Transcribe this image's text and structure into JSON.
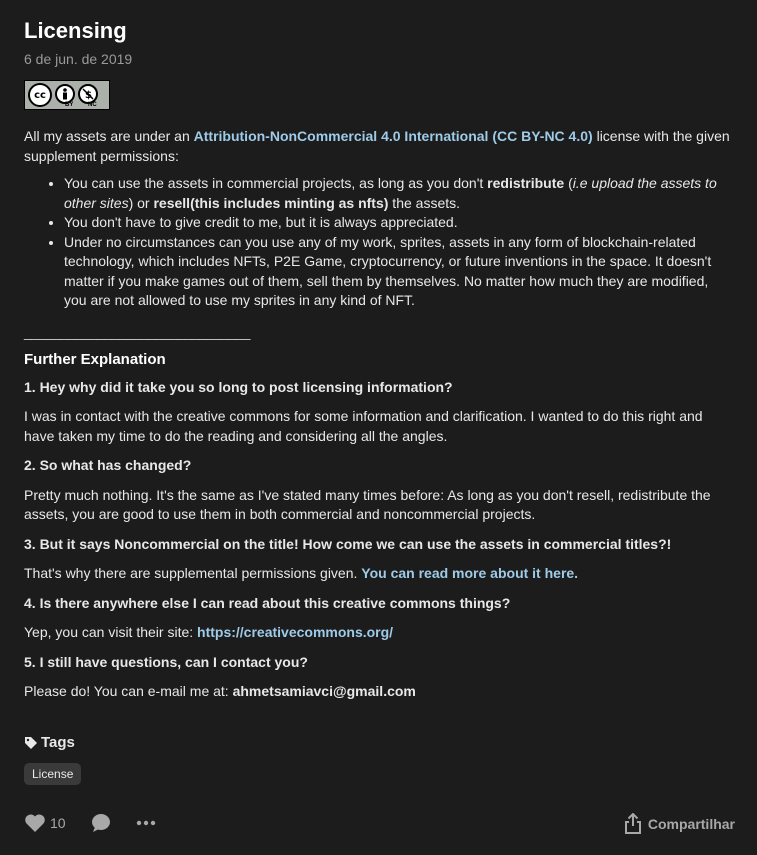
{
  "post": {
    "title": "Licensing",
    "date": "6 de jun. de 2019",
    "badge": {
      "cc": "cc",
      "by": "BY",
      "nc": "NC"
    }
  },
  "intro": {
    "before": "All my assets are under an  ",
    "license_link": "Attribution-NonCommercial 4.0 International (CC BY-NC 4.0)",
    "after": " license with the given supplement permissions:"
  },
  "bullets": {
    "b1": {
      "t1": "You can use the assets in commercial projects, as long as you don't ",
      "b_redistribute": "redistribute",
      "t2": " (",
      "i1": "i.e upload the assets to other sites",
      "t3": ") or ",
      "b_resell": "resell(this includes minting as nfts)",
      "t4": " the assets."
    },
    "b2": "You don't have to give credit to me, but it is always appreciated.",
    "b3": "Under no circumstances can you use any of my work, sprites, assets in any form of blockchain-related technology, which includes NFTs, P2E Game, cryptocurrency, or future inventions in the space. It doesn't matter if you make games out of them, sell them by themselves. No matter how much they are modified, you are not allowed to use my sprites in any kind of NFT."
  },
  "divider": "_______________________________",
  "further": {
    "heading": "Further Explanation",
    "q1": "1. Hey why did it take you so long to post licensing information?",
    "a1": "I was in contact with the creative commons for some information and clarification. I wanted to do this right and have taken my time to do the reading and considering all the angles.",
    "q2": "2. So what has changed?",
    "a2": "Pretty much nothing. It's the same as I've stated many times before: As long as you don't resell, redistribute the assets, you are good to use them in both commercial and noncommercial projects.",
    "q3": "3. But it says Noncommercial on the title! How come we can use the assets in commercial titles?!",
    "a3_text": "That's why there are supplemental permissions given. ",
    "a3_link": "You can read more about it here.",
    "q4": "4. Is there anywhere else I can read about this creative commons things?",
    "a4_text": "Yep, you can visit their site:  ",
    "a4_link": "https://creativecommons.org/",
    "q5": "5. I still have questions, can I contact you?",
    "a5_text": "Please do! You can e-mail me at: ",
    "a5_email": "ahmetsamiavci@gmail.com"
  },
  "tags": {
    "heading": "Tags",
    "items": [
      "License"
    ]
  },
  "actions": {
    "likes": "10",
    "share": "Compartilhar"
  },
  "icons": [
    "tag-icon",
    "heart-icon",
    "comment-icon",
    "more-icon",
    "share-icon"
  ]
}
